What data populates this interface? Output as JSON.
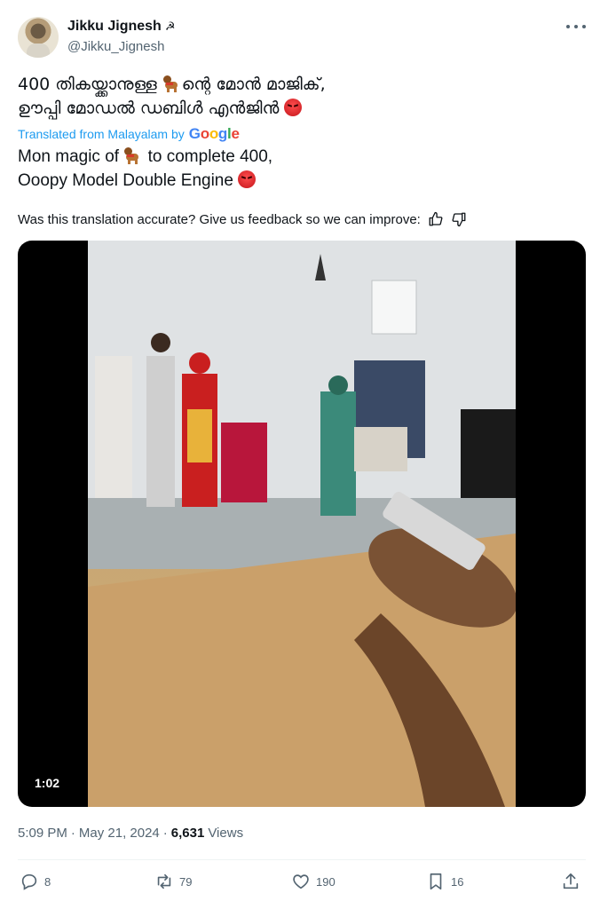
{
  "author": {
    "display_name": "Jikku Jignesh",
    "name_emoji": "☭",
    "handle": "@Jikku_Jignesh"
  },
  "tweet": {
    "original_line1_a": "400 തികയ്ക്കാനുള്ള ",
    "original_line1_b": "ന്റെ മോൻ മാജിക്,",
    "original_line2": "ഊപ്പി മോഡൽ ഡബിൾ എൻജിൻ ",
    "translated_from": "Translated from Malayalam by",
    "google": [
      "G",
      "o",
      "o",
      "g",
      "l",
      "e"
    ],
    "translation_line1_a": "Mon magic of ",
    "translation_line1_b": " to complete 400,",
    "translation_line2": "Ooopy Model Double Engine ",
    "feedback_prompt": "Was this translation accurate? Give us feedback so we can improve:"
  },
  "media": {
    "duration": "1:02"
  },
  "meta": {
    "time": "5:09 PM",
    "sep1": "·",
    "date": "May 21, 2024",
    "sep2": "·",
    "views_count": "6,631",
    "views_label": "Views"
  },
  "actions": {
    "replies": "8",
    "reposts": "79",
    "likes": "190",
    "bookmarks": "16"
  },
  "icons": [
    "more-icon",
    "thumbs-up-icon",
    "thumbs-down-icon",
    "reply-icon",
    "repost-icon",
    "like-icon",
    "bookmark-icon",
    "share-icon"
  ],
  "colors": {
    "link": "#1d9bf0",
    "secondary_text": "#536471",
    "primary_text": "#0f1419"
  }
}
